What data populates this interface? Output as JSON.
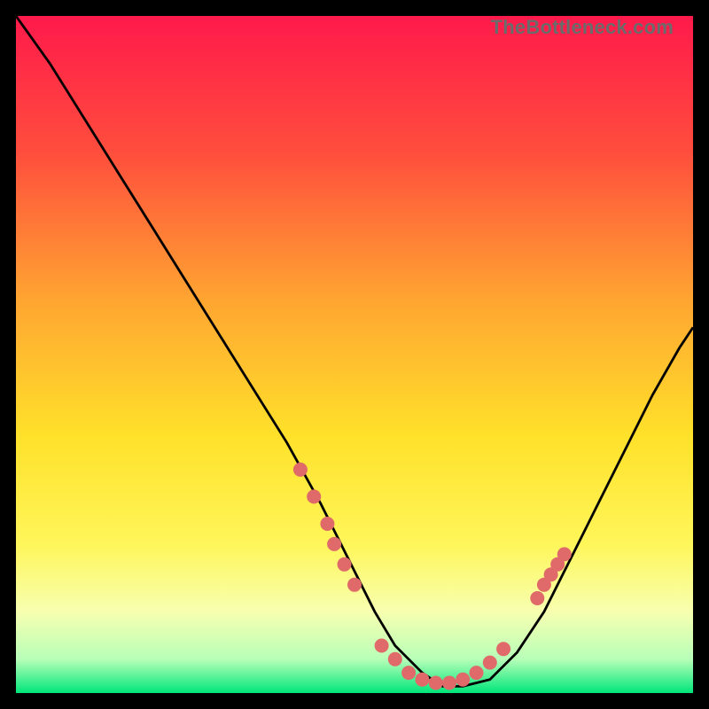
{
  "watermark": "TheBottleneck.com",
  "chart_data": {
    "type": "line",
    "title": "",
    "xlabel": "",
    "ylabel": "",
    "xlim": [
      0,
      100
    ],
    "ylim": [
      0,
      100
    ],
    "grid": false,
    "legend": false,
    "background_gradient": {
      "stops": [
        {
          "offset": 0.0,
          "color": "#ff1a4b"
        },
        {
          "offset": 0.2,
          "color": "#ff4d3d"
        },
        {
          "offset": 0.42,
          "color": "#ffa531"
        },
        {
          "offset": 0.62,
          "color": "#ffe12a"
        },
        {
          "offset": 0.78,
          "color": "#fff65a"
        },
        {
          "offset": 0.88,
          "color": "#f7ffb0"
        },
        {
          "offset": 0.95,
          "color": "#b8ffb8"
        },
        {
          "offset": 1.0,
          "color": "#00e67a"
        }
      ]
    },
    "series": [
      {
        "name": "bottleneck-curve",
        "color": "#000000",
        "x": [
          0,
          5,
          10,
          15,
          20,
          25,
          30,
          35,
          40,
          45,
          50,
          53,
          56,
          60,
          63,
          66,
          70,
          74,
          78,
          82,
          86,
          90,
          94,
          98,
          100
        ],
        "y": [
          100,
          93,
          85,
          77,
          69,
          61,
          53,
          45,
          37,
          28,
          18,
          12,
          7,
          3,
          1,
          1,
          2,
          6,
          12,
          20,
          28,
          36,
          44,
          51,
          54
        ]
      }
    ],
    "markers": {
      "name": "highlighted-points",
      "color": "#e06a6a",
      "radius": 8,
      "points": [
        {
          "x": 42,
          "y": 33
        },
        {
          "x": 44,
          "y": 29
        },
        {
          "x": 46,
          "y": 25
        },
        {
          "x": 47,
          "y": 22
        },
        {
          "x": 48.5,
          "y": 19
        },
        {
          "x": 50,
          "y": 16
        },
        {
          "x": 54,
          "y": 7
        },
        {
          "x": 56,
          "y": 5
        },
        {
          "x": 58,
          "y": 3
        },
        {
          "x": 60,
          "y": 2
        },
        {
          "x": 62,
          "y": 1.5
        },
        {
          "x": 64,
          "y": 1.5
        },
        {
          "x": 66,
          "y": 2
        },
        {
          "x": 68,
          "y": 3
        },
        {
          "x": 70,
          "y": 4.5
        },
        {
          "x": 72,
          "y": 6.5
        },
        {
          "x": 77,
          "y": 14
        },
        {
          "x": 78,
          "y": 16
        },
        {
          "x": 79,
          "y": 17.5
        },
        {
          "x": 80,
          "y": 19
        },
        {
          "x": 81,
          "y": 20.5
        }
      ]
    }
  }
}
